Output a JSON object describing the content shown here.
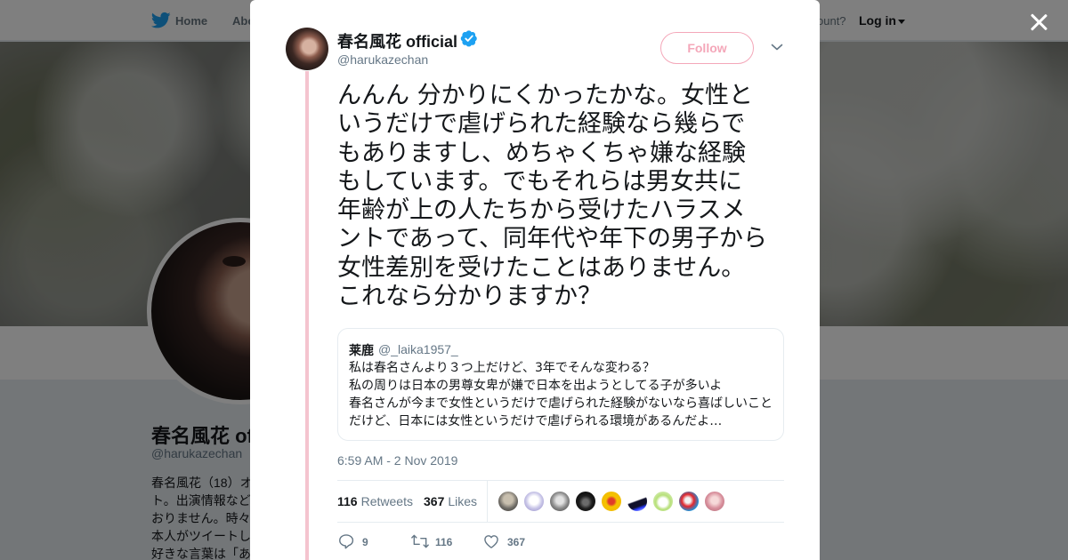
{
  "nav": {
    "home_label": "Home",
    "about_label": "Abo",
    "account_prompt": "ccount?",
    "login_label": "Log in"
  },
  "profile": {
    "name": "春名風花 of",
    "handle": "@harukazechan",
    "bio_lines": [
      "春名風花（18）オ",
      "ト。出演情報など",
      "おりません。時々",
      "本人がツイートし",
      "好きな言葉は「あ"
    ]
  },
  "tweet": {
    "author_name": "春名風花 official",
    "author_handle": "@harukazechan",
    "verified": true,
    "follow_label": "Follow",
    "text_lines": [
      "んんん 分かりにくかったかな。女性と",
      "いうだけで虐げられた経験なら幾らで",
      "もありますし、めちゃくちゃ嫌な経験",
      "もしています。でもそれらは男女共に",
      "年齢が上の人たちから受けたハラスメ",
      "ントであって、同年代や年下の男子から",
      "女性差別を受けたことはありません。",
      "これなら分かりますか？"
    ],
    "quote": {
      "author": "莱鹿",
      "handle": "@_laika1957_",
      "lines": [
        "私は春名さんより３つ上だけど、3年でそんな変わる？",
        "私の周りは日本の男尊女卑が嫌で日本を出ようとしてる子が多いよ",
        "春名さんが今まで女性というだけで虐げられた経験がないなら喜ばしいこと",
        "だけど、日本には女性というだけで虐げられる環境があるんだよ…"
      ]
    },
    "timestamp": "6:59 AM - 2 Nov 2019",
    "retweets_count": "116",
    "retweets_label": "Retweets",
    "likes_count": "367",
    "likes_label": "Likes",
    "actions": {
      "reply_count": "9",
      "retweet_count": "116",
      "like_count": "367"
    }
  },
  "colors": {
    "accent_pink": "#f4a7b9",
    "thread_line": "#f4c4cf",
    "verified_blue": "#1da1f2",
    "secondary_text": "#657786"
  },
  "icons": [
    "twitter-bird-icon",
    "verified-badge-icon",
    "chevron-down-icon",
    "close-icon",
    "reply-icon",
    "retweet-icon",
    "heart-icon"
  ]
}
